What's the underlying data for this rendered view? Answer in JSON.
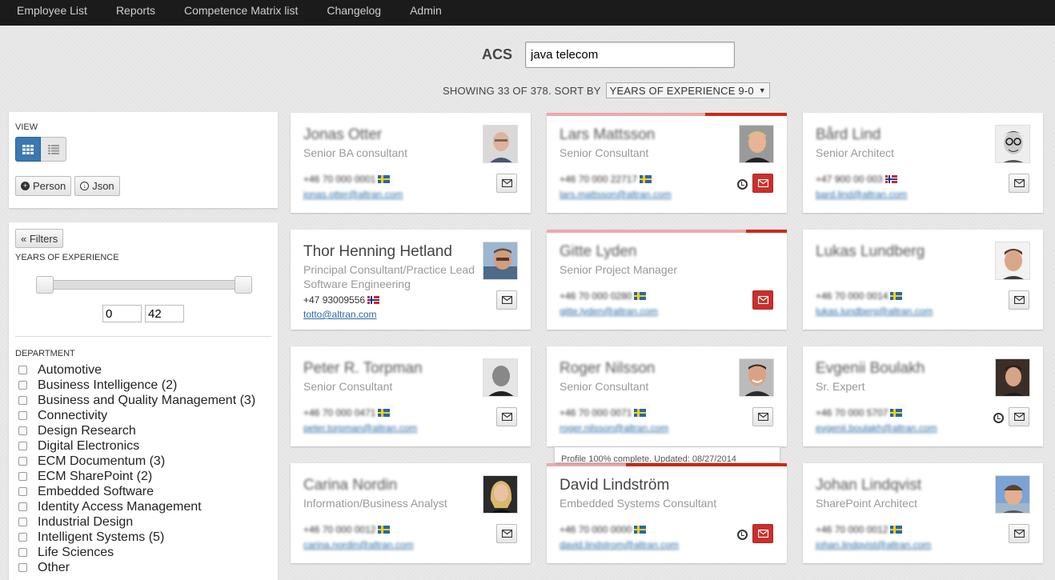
{
  "nav": [
    "Employee List",
    "Reports",
    "Competence Matrix list",
    "Changelog",
    "Admin"
  ],
  "search": {
    "label": "ACS",
    "value": "java telecom"
  },
  "sort": {
    "showing": "SHOWING 33 OF 378. SORT BY",
    "selected": "YEARS OF EXPERIENCE 9-0"
  },
  "view": {
    "label": "VIEW",
    "grid_icon": "grid-icon",
    "list_icon": "list-icon",
    "person_btn": "Person",
    "json_btn": "Json"
  },
  "filters": {
    "button": "« Filters",
    "yoe_label": "YEARS OF EXPERIENCE",
    "yoe_min": "0",
    "yoe_max": "42",
    "dept_label": "DEPARTMENT",
    "departments": [
      "Automotive",
      "Business Intelligence (2)",
      "Business and Quality Management (3)",
      "Connectivity",
      "Design Research",
      "Digital Electronics",
      "ECM Documentum (3)",
      "ECM SharePoint (2)",
      "Embedded Software",
      "Identity Access Management",
      "Industrial Design",
      "Intelligent Systems (5)",
      "Life Sciences",
      "Other"
    ]
  },
  "cards": [
    {
      "name": "Jonas Otter",
      "title": "Senior BA consultant",
      "phone": "+46 70 000 0001",
      "email": "jonas.otter@altran.com",
      "flag": "se",
      "progress": 0,
      "clock": false,
      "mail_red": false,
      "name_blur": true,
      "photo": "bald-man"
    },
    {
      "name": "Lars Mattsson",
      "title": "Senior Consultant",
      "phone": "+46 70 000 22717",
      "email": "lars.mattsson@altran.com",
      "flag": "se",
      "progress": 0.34,
      "clock": true,
      "mail_red": true,
      "name_blur": true,
      "photo": "blond-man"
    },
    {
      "name": "Bård Lind",
      "title": "Senior Architect",
      "phone": "+47 900 00 003",
      "email": "bard.lind@altran.com",
      "flag": "no",
      "progress": 0,
      "clock": false,
      "mail_red": false,
      "name_blur": true,
      "photo": "glasses-man"
    },
    {
      "name": "Thor Henning Hetland",
      "title": "Principal Consultant/Practice Lead Software Engineering",
      "phone": "+47 93009556",
      "email": "totto@altran.com",
      "flag": "no",
      "progress": 0,
      "clock": false,
      "mail_red": false,
      "name_blur": false,
      "photo": "outdoor-man"
    },
    {
      "name": "Gitte Lyden",
      "title": "Senior Project Manager",
      "phone": "+46 70 000 0280",
      "email": "gitte.lyden@altran.com",
      "flag": "se",
      "progress": 0.17,
      "clock": false,
      "mail_red": true,
      "name_blur": true,
      "photo": ""
    },
    {
      "name": "Lukas Lundberg",
      "title": "",
      "phone": "+46 70 000 0014",
      "email": "lukas.lundberg@altran.com",
      "flag": "se",
      "progress": 0,
      "clock": false,
      "mail_red": false,
      "name_blur": true,
      "photo": "brown-hair-man"
    },
    {
      "name": "Peter R. Torpman",
      "title": "Senior Consultant",
      "phone": "+46 70 000 0471",
      "email": "peter.torpman@altran.com",
      "flag": "se",
      "progress": 0,
      "clock": false,
      "mail_red": false,
      "name_blur": true,
      "photo": "bw-man"
    },
    {
      "name": "Roger Nilsson",
      "title": "Senior Consultant",
      "phone": "+46 70 000 0071",
      "email": "roger.nilsson@altran.com",
      "flag": "se",
      "progress": 0,
      "clock": false,
      "mail_red": false,
      "name_blur": true,
      "photo": "smiling-man"
    },
    {
      "name": "Evgenii Boulakh",
      "title": "Sr. Expert",
      "phone": "+46 70 000 5707",
      "email": "evgenii.boulakh@altran.com",
      "flag": "se",
      "progress": 0,
      "clock": true,
      "mail_red": false,
      "name_blur": true,
      "photo": "young-man"
    },
    {
      "name": "Carina Nordin",
      "title": "Information/Business Analyst",
      "phone": "+46 70 000 0012",
      "email": "carina.nordin@altran.com",
      "flag": "se",
      "progress": 0,
      "clock": false,
      "mail_red": false,
      "name_blur": true,
      "photo": "blonde-woman"
    },
    {
      "name": "David Lindström",
      "title": "Embedded Systems Consultant",
      "phone": "+46 70 000 0000",
      "email": "david.lindstrom@altran.com",
      "flag": "se",
      "progress": 0.67,
      "clock": true,
      "mail_red": true,
      "name_blur": false,
      "photo": ""
    },
    {
      "name": "Johan Lindqvist",
      "title": "SharePoint Architect",
      "phone": "+46 70 000 0012",
      "email": "johan.lindqvist@altran.com",
      "flag": "se",
      "progress": 0,
      "clock": false,
      "mail_red": false,
      "name_blur": true,
      "photo": "beanie-man"
    }
  ],
  "tooltip": "Profile 100% complete. Updated: 08/27/2014",
  "icons": {
    "mail": "envelope-icon",
    "clock": "clock-icon"
  },
  "colors": {
    "accent": "#3a78b0",
    "alert": "#c9302c",
    "progress_bg": "#eeaaaa",
    "progress_fill": "#cc2a1a"
  }
}
